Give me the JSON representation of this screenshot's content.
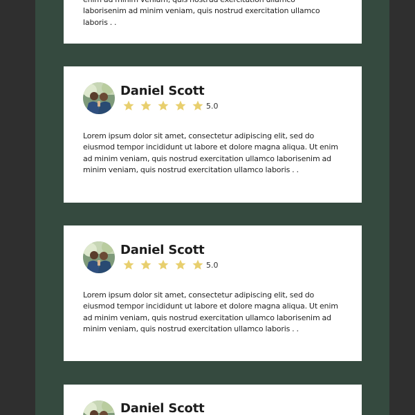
{
  "colors": {
    "page_background": "#2f2f2f",
    "panel_background": "#354a3f",
    "card_background": "#ffffff",
    "star_color": "#e8cf6e"
  },
  "reviews": [
    {
      "text_visible_lines": [
        "enim ad minim veniam, quis nostrud exercitation ullamco",
        "laborisenim ad minim veniam, quis nostrud exercitation ullamco",
        "laboris . ."
      ]
    },
    {
      "name": "Daniel Scott",
      "rating": "5.0",
      "stars": 5,
      "text": "Lorem ipsum dolor sit amet, consectetur adipiscing elit, sed do eiusmod tempor incididunt ut labore et dolore magna aliqua. Ut enim ad minim veniam, quis nostrud exercitation ullamco laborisenim ad minim veniam, quis nostrud exercitation ullamco laboris . ."
    },
    {
      "name": "Daniel Scott",
      "rating": "5.0",
      "stars": 5,
      "text": "Lorem ipsum dolor sit amet, consectetur adipiscing elit, sed do eiusmod tempor incididunt ut labore et dolore magna aliqua. Ut enim ad minim veniam, quis nostrud exercitation ullamco laborisenim ad minim veniam, quis nostrud exercitation ullamco laboris . ."
    },
    {
      "name": "Daniel Scott"
    }
  ]
}
